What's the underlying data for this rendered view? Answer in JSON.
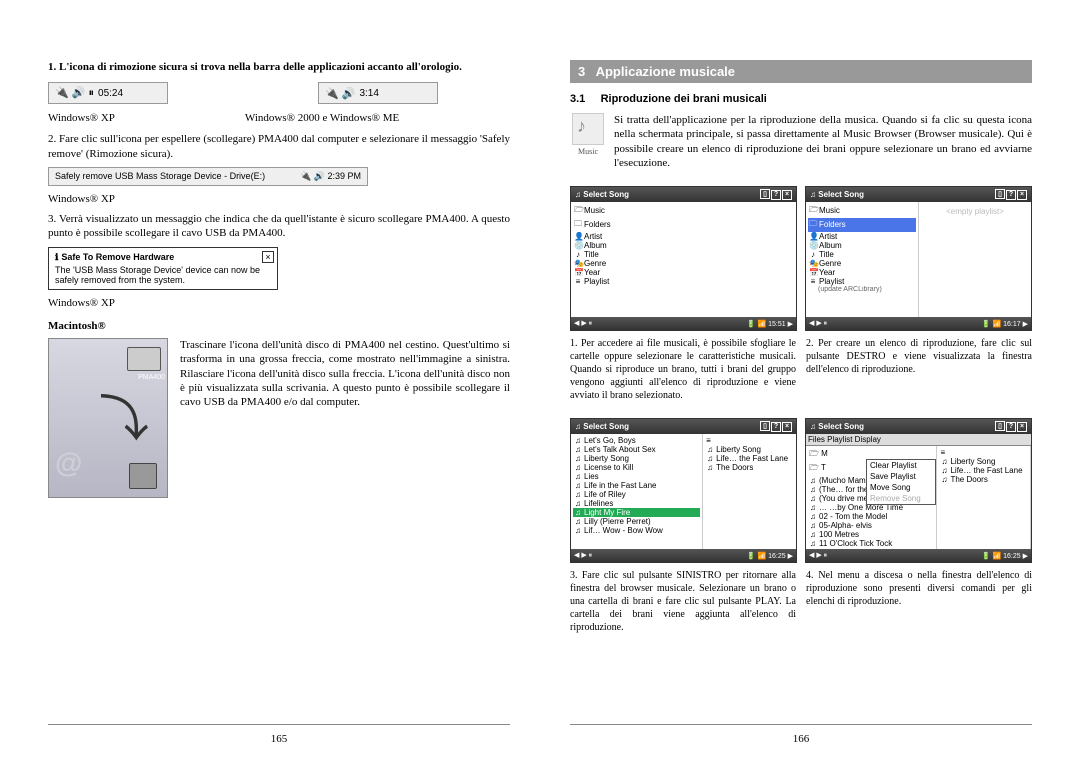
{
  "left": {
    "step1": "1. L'icona di rimozione sicura si trova nella barra delle applicazioni accanto all'orologio.",
    "tray_xp_time": "05:24",
    "tray_2k_time": "3:14",
    "cap_xp": "Windows® XP",
    "cap_2k": "Windows® 2000 e Windows® ME",
    "step2": "2. Fare clic sull'icona per espellere (scollegare) PMA400 dal computer e selezionare il messaggio 'Safely remove' (Rimozione sicura).",
    "safe_remove_text": "Safely remove USB Mass Storage Device - Drive(E:)",
    "safe_remove_time": "2:39 PM",
    "cap_xp2": "Windows® XP",
    "step3": "3. Verrà visualizzato un messaggio che indica che da quell'istante è sicuro scollegare PMA400. A questo punto è possibile scollegare il cavo USB da PMA400.",
    "popup_title": "Safe To Remove Hardware",
    "popup_body": "The 'USB Mass Storage Device' device can now be safely removed from the system.",
    "cap_xp3": "Windows® XP",
    "mac_title": "Macintosh®",
    "mac_para": "Trascinare l'icona dell'unità disco di PMA400 nel cestino. Quest'ultimo si trasforma in una grossa freccia, come mostrato nell'immagine a sinistra. Rilasciare l'icona dell'unità disco sulla freccia. L'icona dell'unità disco non è più visualizzata sulla scrivania. A questo punto è possibile scollegare il cavo USB da PMA400 e/o dal computer.",
    "mac_label": "PMA400",
    "page_num": "165"
  },
  "right": {
    "section_num": "3",
    "section_title": "Applicazione musicale",
    "sub_num": "3.1",
    "sub_title": "Riproduzione dei brani musicali",
    "icon_label": "Music",
    "desc": "Si tratta dell'applicazione per la riproduzione della musica. Quando si fa clic su questa icona nella schermata principale, si passa direttamente al Music Browser (Browser musicale). Qui è possibile creare un elenco di riproduzione dei brani oppure selezionare un brano ed avviarne l'esecuzione.",
    "shot_a_title": "Select Song",
    "browser_cats": [
      "Music",
      "Folders",
      "Artist",
      "Album",
      "Title",
      "Genre",
      "Year",
      "Playlist"
    ],
    "update_lib": "(update ARCLibrary)",
    "empty_playlist": "<empty playlist>",
    "status_a": "15:51",
    "status_b": "16:17",
    "cap1": "1. Per accedere ai file musicali, è possibile sfogliare le cartelle oppure selezionare le caratteristiche musicali. Quando si riproduce un brano, tutti i brani del gruppo vengono aggiunti all'elenco di riproduzione e viene avviato il brano selezionato.",
    "cap2": "2. Per creare un elenco di riproduzione, fare clic sul pulsante DESTRO e viene visualizzata la finestra dell'elenco di riproduzione.",
    "songs_left": [
      "Let's Go, Boys",
      "Let's Talk About Sex",
      "Liberty Song",
      "License to Kill",
      "Lies",
      "Life in the Fast Lane",
      "Life of Riley",
      "Lifelines",
      "Light My Fire",
      "Lilly (Pierre Perret)",
      "Lif… Wow - Bow Wow"
    ],
    "song_sel": "Light My Fire",
    "playlist_right": [
      "Liberty Song",
      "Life… the Fast Lane",
      "The Doors"
    ],
    "tabs": "Files   Playlist   Display",
    "menu_items": [
      "Clear Playlist",
      "Save Playlist",
      "Move Song",
      "Remove Song"
    ],
    "songs_d": [
      "(Mucho Mambo) Sway",
      "(The… for the Holidays",
      "(You drive me) Crazy",
      "… …by One More Time",
      "02 - Tom the Model",
      "05-Alpha- elvis",
      "100 Metres",
      "11 O'Clock Tick Tock"
    ],
    "status_c": "16:25",
    "status_d": "16:25",
    "cap3": "3. Fare clic sul pulsante SINISTRO per ritornare alla finestra del browser musicale. Selezionare un brano o una cartella di brani e fare clic sul pulsante PLAY. La cartella dei brani viene aggiunta all'elenco di riproduzione.",
    "cap4": "4. Nel menu a discesa o nella finestra dell'elenco di riproduzione sono presenti diversi comandi per gli elenchi di riproduzione.",
    "page_num": "166"
  }
}
